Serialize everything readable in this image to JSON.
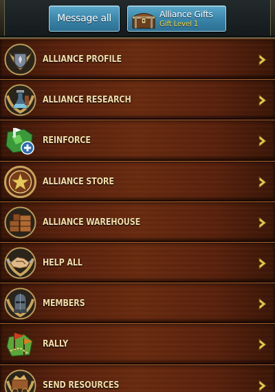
{
  "header": {
    "message_all_label": "Message all",
    "alliance_gifts": {
      "title": "Alliance Gifts",
      "subtitle": "Gift Level 1",
      "icon": "treasure-chest-icon"
    }
  },
  "menu": {
    "items": [
      {
        "label": "ALLIANCE PROFILE",
        "icon": "crested-shield-icon"
      },
      {
        "label": "ALLIANCE RESEARCH",
        "icon": "research-flask-icon"
      },
      {
        "label": "REINFORCE",
        "icon": "reinforce-map-icon"
      },
      {
        "label": "ALLIANCE STORE",
        "icon": "star-medallion-icon"
      },
      {
        "label": "ALLIANCE WAREHOUSE",
        "icon": "warehouse-crates-icon"
      },
      {
        "label": "HELP ALL",
        "icon": "handshake-icon"
      },
      {
        "label": "MEMBERS",
        "icon": "knight-helmet-icon"
      },
      {
        "label": "RALLY",
        "icon": "rally-flags-icon"
      },
      {
        "label": "SEND RESOURCES",
        "icon": "resource-cart-icon"
      }
    ],
    "arrow_icon": "chevron-right-icon"
  },
  "colors": {
    "wood": "#5a220d",
    "label_text": "#f4dca8",
    "button_blue": "#3a87ab",
    "gift_level_text": "#f2d640",
    "arrow_yellow": "#e9c94a"
  }
}
